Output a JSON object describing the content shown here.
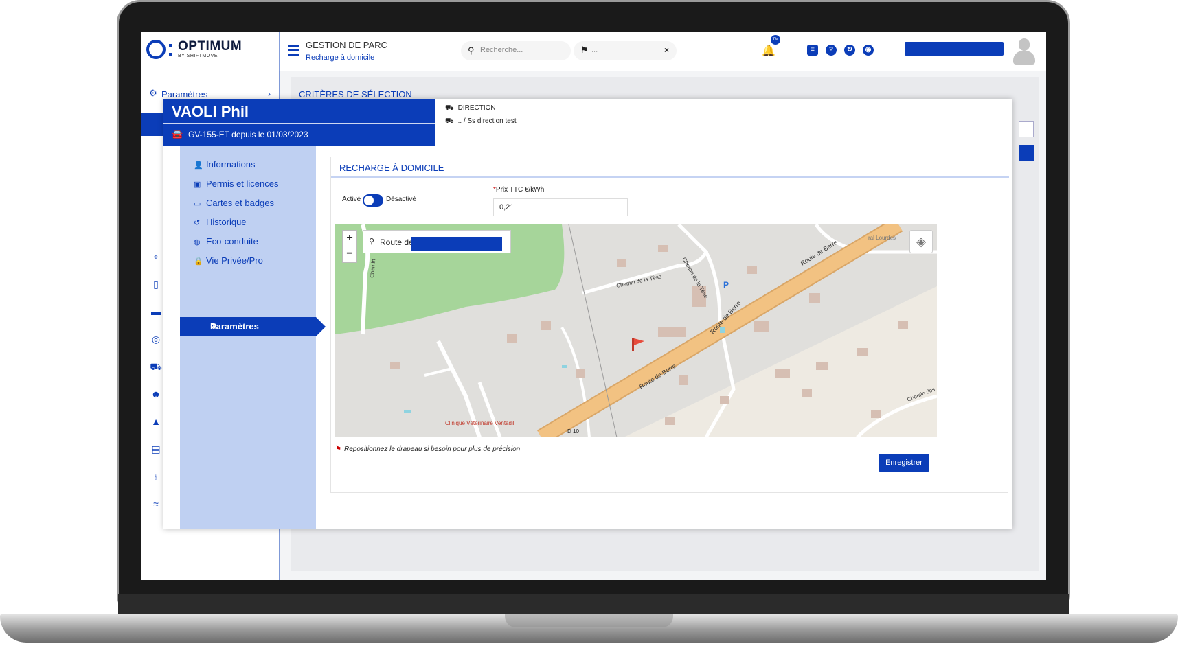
{
  "brand": {
    "name": "OPTIMUM",
    "sub": "BY SHIFTMOVE"
  },
  "header": {
    "section": "GESTION DE PARC",
    "page": "Recharge à domicile",
    "search_placeholder": "Recherche...",
    "location_placeholder": "...",
    "clear_symbol": "×",
    "notif_badge": "TM"
  },
  "sidebar": {
    "parametres_label": "Paramètres",
    "criteria_label": "CRITÈRES DE SÉLECTION"
  },
  "driver": {
    "name": "VAOLI Phil",
    "vehicle": "GV-155-ET depuis le 01/03/2023",
    "direction": "DIRECTION",
    "subdirection": ".. / Ss direction test"
  },
  "menu": {
    "items": [
      {
        "label": "Informations",
        "icon": "user-icon"
      },
      {
        "label": "Permis et licences",
        "icon": "id-card-icon"
      },
      {
        "label": "Cartes et badges",
        "icon": "credit-card-icon"
      },
      {
        "label": "Historique",
        "icon": "history-icon"
      },
      {
        "label": "Eco-conduite",
        "icon": "globe-icon"
      },
      {
        "label": "Vie Privée/Pro",
        "icon": "lock-icon"
      }
    ],
    "active": {
      "label": "Paramètres",
      "icon": "gear-icon"
    }
  },
  "panel": {
    "title": "RECHARGE À DOMICILE",
    "toggle_on_label": "Activé",
    "toggle_off_label": "Désactivé",
    "toggle_state": "active",
    "price_label": "Prix TTC €/kWh",
    "required_mark": "*",
    "price_value": "0,21",
    "address_prefix": "Route de",
    "hint": "Repositionnez le drapeau si besoin pour plus de précision",
    "save_label": "Enregistrer"
  },
  "map": {
    "labels": {
      "route_berre_1": "Route de Berre",
      "route_berre_2": "Route de Berre",
      "route_berre_3": "Route de Berre",
      "chemin_tese_1": "Chemin de la Tèse",
      "chemin_tese_2": "Chemin de la Tèse",
      "chemin_left": "Chemin",
      "chemin_des": "Chemin des",
      "d10": "D 10",
      "clinic": "Clinique Vétérinaire Ventadil",
      "lourdes": "ral Lourdes",
      "parking": "P"
    }
  },
  "colors": {
    "accent": "#0b3db8",
    "submenu_bg": "#bfd0f2",
    "road": "#f2c282",
    "forest": "#a6d59a"
  }
}
